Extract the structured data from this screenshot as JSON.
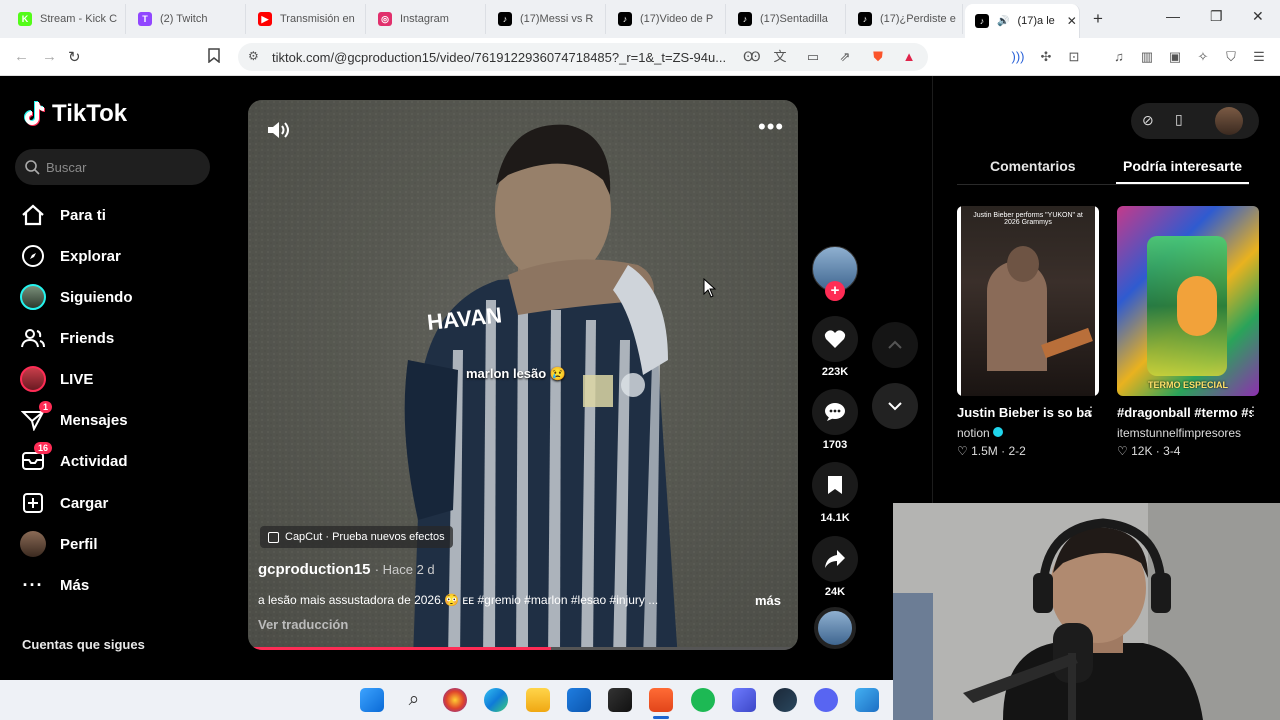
{
  "browser": {
    "tabs": [
      {
        "title": "Stream - Kick C",
        "icon": "kick-icon",
        "color": "#53fc18",
        "letter": "K"
      },
      {
        "title": "(2) Twitch",
        "icon": "twitch-icon",
        "color": "#9146ff",
        "letter": "T"
      },
      {
        "title": "Transmisión en",
        "icon": "youtube-icon",
        "color": "#ff0000",
        "letter": "▶"
      },
      {
        "title": "Instagram",
        "icon": "instagram-icon",
        "color": "#e1306c",
        "letter": "◎"
      },
      {
        "title": "(17)Messi vs R",
        "icon": "tiktok-icon",
        "color": "#000000",
        "letter": "♪"
      },
      {
        "title": "(17)Video de P",
        "icon": "tiktok-icon",
        "color": "#000000",
        "letter": "♪"
      },
      {
        "title": "(17)Sentadilla",
        "icon": "tiktok-icon",
        "color": "#000000",
        "letter": "♪"
      },
      {
        "title": "(17)¿Perdiste e",
        "icon": "tiktok-icon",
        "color": "#000000",
        "letter": "♪"
      },
      {
        "title": "(17)a le",
        "icon": "tiktok-icon",
        "color": "#000000",
        "letter": "♪",
        "active": true
      }
    ],
    "new_tab": "+",
    "url": "tiktok.com/@gcproduction15/video/7619122936074718485?_r=1&_t=ZS-94u..."
  },
  "sidebar": {
    "logo": "TikTok",
    "search_placeholder": "Buscar",
    "items": [
      {
        "label": "Para ti",
        "icon": "home-icon"
      },
      {
        "label": "Explorar",
        "icon": "compass-icon"
      },
      {
        "label": "Siguiendo",
        "icon": "following-avatar-icon"
      },
      {
        "label": "Friends",
        "icon": "friends-icon"
      },
      {
        "label": "LIVE",
        "icon": "live-icon"
      },
      {
        "label": "Mensajes",
        "icon": "messages-icon",
        "badge": "1"
      },
      {
        "label": "Actividad",
        "icon": "activity-icon",
        "badge": "16"
      },
      {
        "label": "Cargar",
        "icon": "upload-icon"
      },
      {
        "label": "Perfil",
        "icon": "profile-avatar-icon"
      },
      {
        "label": "Más",
        "icon": "more-icon"
      }
    ],
    "following_header": "Cuentas que sigues"
  },
  "video": {
    "caption_overlay": "marlon lesão 😢",
    "capcut_label": "CapCut · Prueba nuevos efectos",
    "author": "gcproduction15",
    "posted": "· Hace 2 d",
    "description": "a lesão mais assustadora de 2026.😳 ᴇᴇ #gremio #marlon #lesao #injury ...",
    "more_label": "más",
    "translate_label": "Ver traducción",
    "progress": 0.55,
    "accent": "#fe2c55"
  },
  "actions": {
    "likes": "223K",
    "comments": "1703",
    "saves": "14.1K",
    "shares": "24K"
  },
  "right_panel": {
    "tabs": [
      "Comentarios",
      "Podría interesarte"
    ],
    "active_tab": "Podría interesarte",
    "cards": [
      {
        "title": "Justin Bieber is so back. With his...",
        "user": "notion",
        "verified": true,
        "likes": "1.5M",
        "meta": "2-2",
        "thumb_text": "Justin Bieber performs \"YUKON\" at 2026 Grammys"
      },
      {
        "title": "#dragonball #termo #shenlon...",
        "user": "itemstunnelfimpresores",
        "verified": false,
        "likes": "12K",
        "meta": "3-4",
        "thumb_text": "TERMO ESPECIAL"
      }
    ]
  }
}
